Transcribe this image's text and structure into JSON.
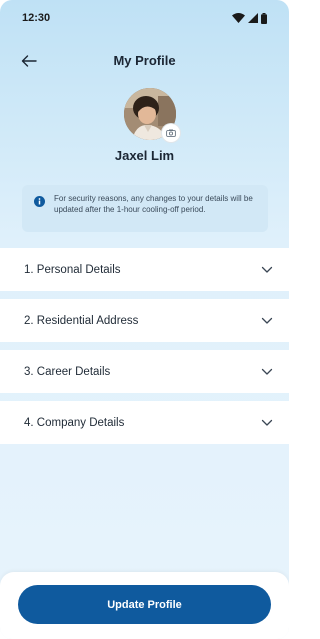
{
  "status_bar": {
    "time": "12:30"
  },
  "header": {
    "title": "My Profile"
  },
  "profile": {
    "name": "Jaxel Lim"
  },
  "notice": {
    "text": "For security reasons, any changes to your details will be updated after the 1-hour cooling-off period."
  },
  "sections": [
    {
      "label": "1. Personal Details"
    },
    {
      "label": "2. Residential Address"
    },
    {
      "label": "3. Career Details"
    },
    {
      "label": "4. Company Details"
    }
  ],
  "footer": {
    "update_label": "Update Profile"
  },
  "colors": {
    "primary": "#0f5a9e",
    "background_top": "#bfe1f5",
    "notice_bg": "#d2e8f6",
    "info_icon": "#0f5a9e"
  },
  "icons": {
    "back": "arrow-left-icon",
    "camera": "camera-icon",
    "info": "info-icon",
    "chevron": "chevron-down-icon",
    "wifi": "wifi-icon",
    "signal": "signal-icon",
    "battery": "battery-icon"
  }
}
